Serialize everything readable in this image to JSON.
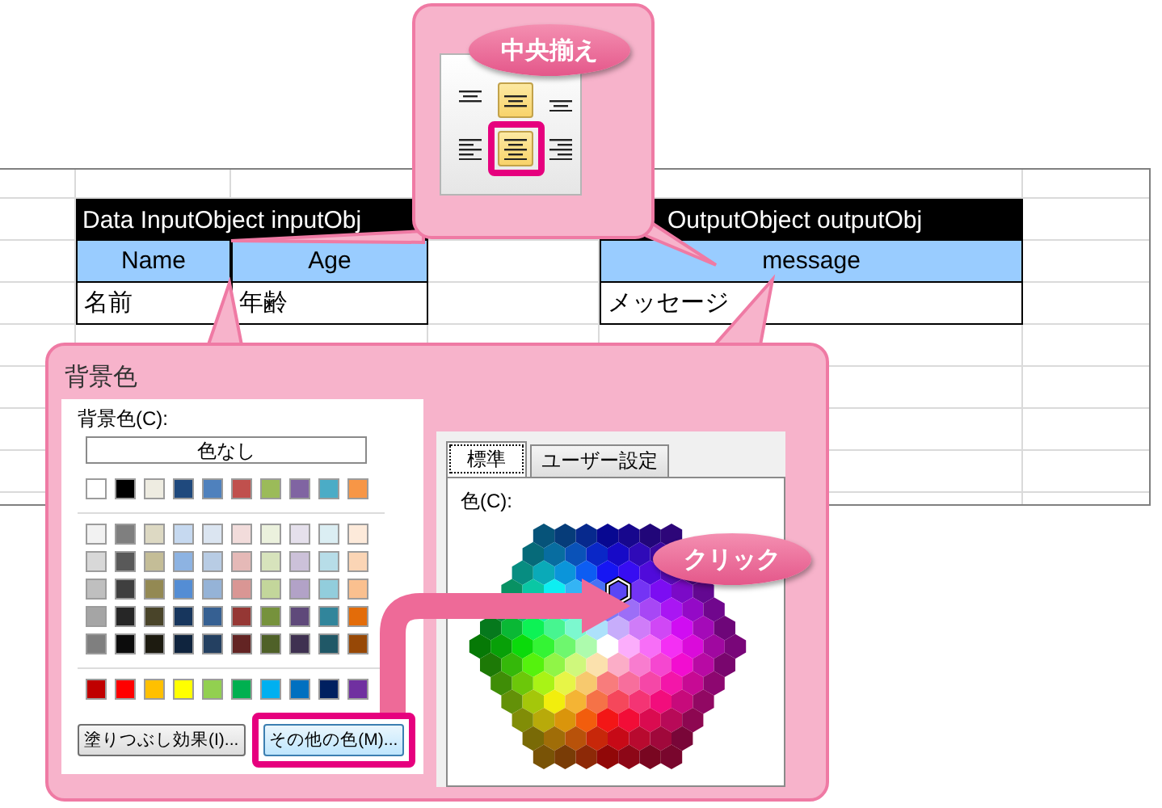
{
  "spreadsheet": {
    "input_table": {
      "title": "Data InputObject inputObj",
      "columns": [
        "Name",
        "Age"
      ],
      "rows": [
        [
          "名前",
          "年齢"
        ]
      ]
    },
    "output_table": {
      "title": "OutputObject outputObj",
      "columns": [
        "message"
      ],
      "rows": [
        [
          "メッセージ"
        ]
      ]
    }
  },
  "ribbon_callout": {
    "bubble": "中央揃え",
    "align_buttons": [
      {
        "kind": "top",
        "selected": false
      },
      {
        "kind": "middle",
        "selected": true
      },
      {
        "kind": "bottom",
        "selected": false
      },
      {
        "kind": "left",
        "selected": false
      },
      {
        "kind": "center",
        "selected": true
      },
      {
        "kind": "right",
        "selected": false
      }
    ]
  },
  "fill_callout": {
    "title": "背景色",
    "palette": {
      "label": "背景色(C):",
      "no_color_button": "色なし",
      "theme_rows": [
        [
          {
            "color": "#ffffff"
          },
          {
            "color": "#000000"
          },
          {
            "color": "#eeece1"
          },
          {
            "color": "#1f497d"
          },
          {
            "color": "#4f81bd"
          },
          {
            "color": "#c0504d"
          },
          {
            "color": "#9bbb59"
          },
          {
            "color": "#8064a2"
          },
          {
            "color": "#4bacc6"
          },
          {
            "color": "#f79646"
          }
        ],
        [
          {
            "color": "#f2f2f2"
          },
          {
            "color": "#7f7f7f"
          },
          {
            "color": "#ddd9c3"
          },
          {
            "color": "#c6d9f0"
          },
          {
            "color": "#dbe5f1"
          },
          {
            "color": "#f2dcdb"
          },
          {
            "color": "#ebf1dd"
          },
          {
            "color": "#e5e0ec"
          },
          {
            "color": "#dbeef3"
          },
          {
            "color": "#fdeada"
          }
        ],
        [
          {
            "color": "#d8d8d8"
          },
          {
            "color": "#595959"
          },
          {
            "color": "#c4bd97"
          },
          {
            "color": "#8db3e2"
          },
          {
            "color": "#b8cce4"
          },
          {
            "color": "#e5b9b7"
          },
          {
            "color": "#d7e3bc"
          },
          {
            "color": "#ccc1d9"
          },
          {
            "color": "#b7dde8"
          },
          {
            "color": "#fbd5b5"
          }
        ],
        [
          {
            "color": "#bfbfbf"
          },
          {
            "color": "#3f3f3f"
          },
          {
            "color": "#938953"
          },
          {
            "color": "#548dd4"
          },
          {
            "color": "#95b3d7"
          },
          {
            "color": "#d99694"
          },
          {
            "color": "#c3d69b"
          },
          {
            "color": "#b2a2c7"
          },
          {
            "color": "#92cddc"
          },
          {
            "color": "#fac08f"
          }
        ],
        [
          {
            "color": "#a5a5a5"
          },
          {
            "color": "#262626"
          },
          {
            "color": "#494429"
          },
          {
            "color": "#17365d"
          },
          {
            "color": "#366092"
          },
          {
            "color": "#953734"
          },
          {
            "color": "#76923c"
          },
          {
            "color": "#5f497a"
          },
          {
            "color": "#31859b"
          },
          {
            "color": "#e36c09"
          }
        ],
        [
          {
            "color": "#7f7f7f"
          },
          {
            "color": "#0c0c0c"
          },
          {
            "color": "#1d1b10"
          },
          {
            "color": "#0f243e"
          },
          {
            "color": "#244061"
          },
          {
            "color": "#632423"
          },
          {
            "color": "#4f6128"
          },
          {
            "color": "#3f3151"
          },
          {
            "color": "#205867"
          },
          {
            "color": "#974806"
          }
        ]
      ],
      "standard_colors": [
        {
          "color": "#c00000"
        },
        {
          "color": "#ff0000"
        },
        {
          "color": "#ffc000"
        },
        {
          "color": "#ffff00"
        },
        {
          "color": "#92d050"
        },
        {
          "color": "#00b050"
        },
        {
          "color": "#00b0f0"
        },
        {
          "color": "#0070c0"
        },
        {
          "color": "#002060"
        },
        {
          "color": "#7030a0"
        }
      ],
      "fill_effects_button": "塗りつぶし効果(I)...",
      "more_colors_button": "その他の色(M)..."
    },
    "color_dialog": {
      "tabs": [
        {
          "label": "標準",
          "selected": true
        },
        {
          "label": "ユーザー設定",
          "selected": false
        }
      ],
      "label": "色(C):"
    },
    "bubble": "クリック"
  }
}
